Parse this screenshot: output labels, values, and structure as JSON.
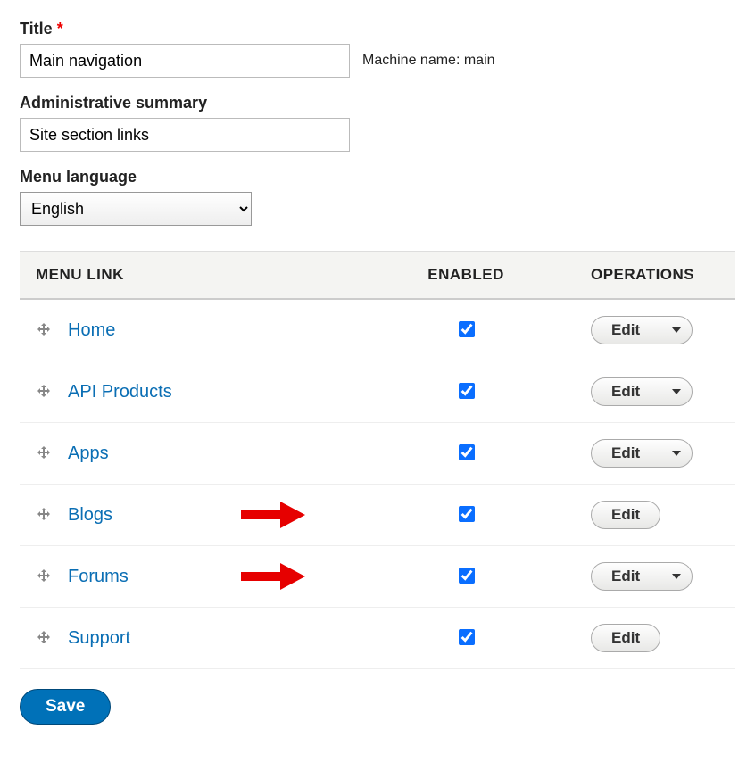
{
  "form": {
    "title_label": "Title",
    "title_value": "Main navigation",
    "machine_name_label": "Machine name:",
    "machine_name_value": "main",
    "summary_label": "Administrative summary",
    "summary_value": "Site section links",
    "language_label": "Menu language",
    "language_value": "English"
  },
  "table": {
    "headers": {
      "link": "MENU LINK",
      "enabled": "ENABLED",
      "ops": "OPERATIONS"
    },
    "edit_label": "Edit",
    "rows": [
      {
        "label": "Home",
        "enabled": true,
        "has_dropdown": true,
        "annotated": false
      },
      {
        "label": "API Products",
        "enabled": true,
        "has_dropdown": true,
        "annotated": false
      },
      {
        "label": "Apps",
        "enabled": true,
        "has_dropdown": true,
        "annotated": false
      },
      {
        "label": "Blogs",
        "enabled": true,
        "has_dropdown": false,
        "annotated": true
      },
      {
        "label": "Forums",
        "enabled": true,
        "has_dropdown": true,
        "annotated": true
      },
      {
        "label": "Support",
        "enabled": true,
        "has_dropdown": false,
        "annotated": false
      }
    ]
  },
  "actions": {
    "save_label": "Save"
  }
}
